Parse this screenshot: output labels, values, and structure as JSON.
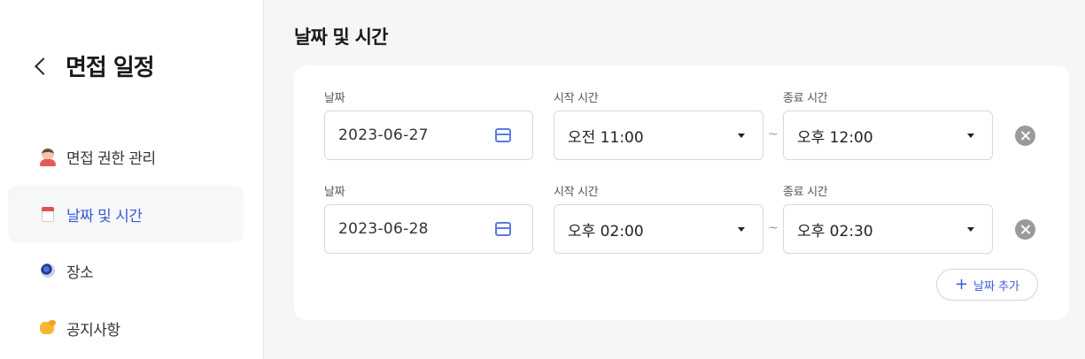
{
  "sidebar": {
    "title": "면접 일정",
    "items": [
      {
        "label": "면접 권한 관리",
        "icon": "person-icon",
        "active": false
      },
      {
        "label": "날짜 및 시간",
        "icon": "calendar-icon",
        "active": true
      },
      {
        "label": "장소",
        "icon": "globe-icon",
        "active": false
      },
      {
        "label": "공지사항",
        "icon": "pointing-hand-icon",
        "active": false
      }
    ]
  },
  "main": {
    "section_title": "날짜 및 시간",
    "labels": {
      "date": "날짜",
      "start": "시작 시간",
      "end": "종료 시간"
    },
    "separator": "~",
    "rows": [
      {
        "date": "2023-06-27",
        "start": "오전 11:00",
        "end": "오후 12:00"
      },
      {
        "date": "2023-06-28",
        "start": "오후 02:00",
        "end": "오후 02:30"
      }
    ],
    "add_button": "날짜 추가"
  },
  "colors": {
    "accent": "#3d5bd9",
    "background": "#f5f6f8",
    "card": "#ffffff"
  }
}
